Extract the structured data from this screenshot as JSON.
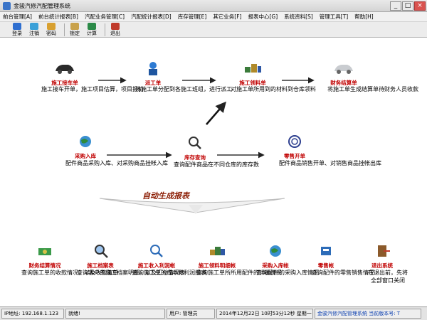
{
  "window": {
    "title": "金骏汽修汽配管理系统"
  },
  "menu": [
    "前台管理[A]",
    "前台统计报表[B]",
    "汽配业务管理[C]",
    "汽配统计报表[D]",
    "库存管理[E]",
    "其它业务[F]",
    "报表中心[G]",
    "系统资料[S]",
    "管理工具[T]",
    "帮助[H]"
  ],
  "toolbar": [
    "登录",
    "注销",
    "密码",
    "锁定",
    "计算",
    "退出"
  ],
  "flow": {
    "repair_order": {
      "label": "施工接车单",
      "desc": "施工接车开单，施工项目估算，项目报价"
    },
    "dispatch": {
      "label": "派工单",
      "desc": "将施工单分配到各施工班组，进行派工"
    },
    "parts_requisition": {
      "label": "施工领料单",
      "desc": "对施工单所用到的材料到仓库领料"
    },
    "finance_settlement": {
      "label": "财务结算单",
      "desc": "将施工单生成结算单待财务人员收款"
    },
    "purchase_in": {
      "label": "采购入库",
      "desc": "配件商品采购入库、对采购商品挂帐入库"
    },
    "stock_query": {
      "label": "库存查询",
      "desc": "查询配件商品在不同仓库的库存数"
    },
    "retail_order": {
      "label": "零售开单",
      "desc": "配件商品销售开单、对销售商品挂帐出库"
    }
  },
  "report_banner": "自动生成报表",
  "reports": [
    {
      "label": "财务结算情况",
      "desc": "查询施工单的收款情况，以及收款清单",
      "icon": "money-icon"
    },
    {
      "label": "施工档案表",
      "desc": "查询客户的施工档案明细，以及汇总情况表",
      "icon": "magnifier-icon"
    },
    {
      "label": "施工收入利润帐",
      "desc": "查询施工单的成本和利润报表",
      "icon": "search-report-icon"
    },
    {
      "label": "施工领料明细帐",
      "desc": "查询施工单所所用配件的详细情况",
      "icon": "parts-detail-icon"
    },
    {
      "label": "采购入库帐",
      "desc": "查询配件的采购入库情况",
      "icon": "globe-icon"
    },
    {
      "label": "零售帐",
      "desc": "查询配件的零售销售情况",
      "icon": "retail-icon"
    },
    {
      "label": "退出系统",
      "desc": "在退出前，先将全部窗口关闭",
      "icon": "exit-icon"
    }
  ],
  "statusbar": {
    "ip": "IP地址: 192.168.1.123",
    "ready": "就绪!",
    "user": "用户: 管理员",
    "datetime": "2014年12月22日  10时53分12秒  星期一",
    "product": "金骏汽修汽配管理系统  当前版本号: T"
  },
  "colors": {
    "label_red": "#c00000",
    "banner": "#8a1a00"
  }
}
